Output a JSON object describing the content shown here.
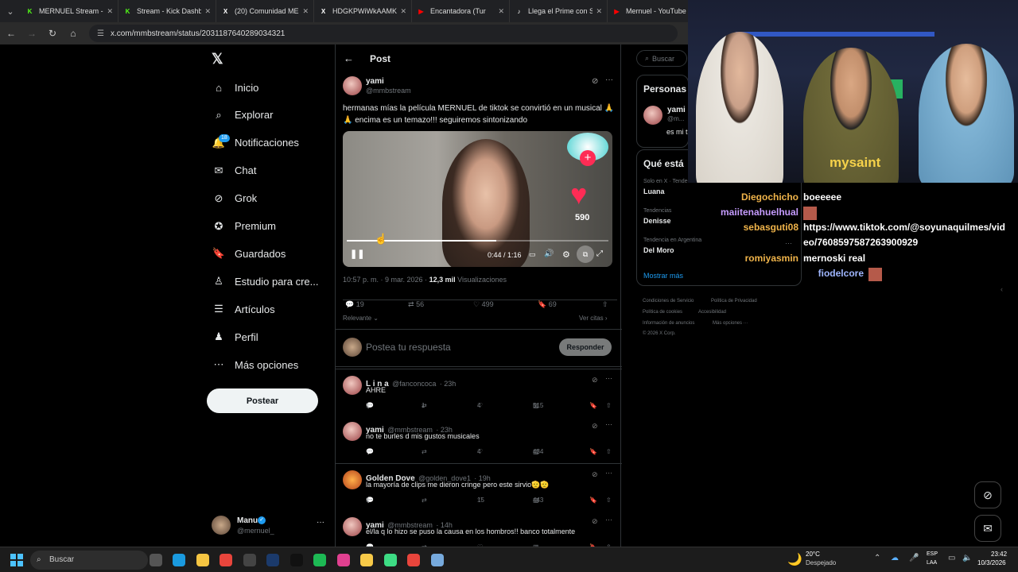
{
  "browser": {
    "tabs": [
      {
        "title": "MERNUEL Stream - V",
        "color": "#53fc18",
        "glyph": "K"
      },
      {
        "title": "Stream - Kick Dashbo",
        "color": "#53fc18",
        "glyph": "K"
      },
      {
        "title": "(20) Comunidad MER",
        "color": "#ffffff",
        "glyph": "X"
      },
      {
        "title": "HDGKPWiWkAAMK8",
        "color": "#ffffff",
        "glyph": "X"
      },
      {
        "title": "Encantadora (Tur",
        "color": "#ff0000",
        "glyph": "▶"
      },
      {
        "title": "Llega el Prime con Sc",
        "color": "#ffffff",
        "glyph": "♪"
      },
      {
        "title": "Mernuel - YouTube",
        "color": "#ff0000",
        "glyph": "▶"
      }
    ],
    "url": "x.com/mmbstream/status/2031187640289034321"
  },
  "sidebar": {
    "items": [
      {
        "label": "Inicio",
        "icon": "home-icon"
      },
      {
        "label": "Explorar",
        "icon": "search-icon"
      },
      {
        "label": "Notificaciones",
        "icon": "bell-icon"
      },
      {
        "label": "Chat",
        "icon": "mail-icon"
      },
      {
        "label": "Grok",
        "icon": "grok-icon"
      },
      {
        "label": "Premium",
        "icon": "premium-icon"
      },
      {
        "label": "Guardados",
        "icon": "bookmark-icon"
      },
      {
        "label": "Estudio para cre...",
        "icon": "studio-icon"
      },
      {
        "label": "Artículos",
        "icon": "articles-icon"
      },
      {
        "label": "Perfil",
        "icon": "person-icon"
      },
      {
        "label": "Más opciones",
        "icon": "more-icon"
      }
    ],
    "notif_badge": "18",
    "post_button": "Postear",
    "account": {
      "name": "Manu",
      "handle": "@mernuel_"
    }
  },
  "post": {
    "header_title": "Post",
    "author": "yami",
    "handle": "@mmbstream",
    "text": "hermanas mías la película MERNUEL de tiktok se convirtió en un musical 🙏🙏 encima es un temazo!!! seguiremos sintonizando",
    "video": {
      "time": "0:44 / 1:16",
      "like_count": "590",
      "progress": 0.57
    },
    "timestamp": "10:57 p. m. · 9 mar. 2026 ·",
    "views": "12,3 mil",
    "views_label": "Visualizaciones",
    "stats": {
      "replies": "19",
      "reposts": "56",
      "likes": "499",
      "bookmarks": "69"
    },
    "sort_label": "Relevante",
    "quotes_link": "Ver citas",
    "reply_placeholder": "Postea tu respuesta",
    "reply_button": "Responder"
  },
  "replies": [
    {
      "name": "L i n a",
      "handle": "@fanconcoca",
      "time": "· 23h",
      "text": "AHRE",
      "replies": "1",
      "reposts": "1",
      "likes": "4",
      "views": "515"
    },
    {
      "name": "yami",
      "handle": "@mmbstream",
      "time": "· 23h",
      "text": "no te burles d mis gustos musicales",
      "replies": "",
      "reposts": "",
      "likes": "4",
      "views": "434"
    },
    {
      "name": "Golden Dove",
      "handle": "@golden_dove1",
      "time": "· 19h",
      "text": "la mayoría de clips me dieron cringe pero este sirvio🫡🫡",
      "replies": "1",
      "reposts": "",
      "likes": "15",
      "views": "443"
    },
    {
      "name": "yami",
      "handle": "@mmbstream",
      "time": "· 14h",
      "text": "el/la q lo hizo se puso la causa en los hombros!! banco totalmente",
      "replies": "",
      "reposts": "",
      "likes": "",
      "views": ""
    }
  ],
  "right": {
    "search_placeholder": "Buscar",
    "people_title": "Personas",
    "people": [
      {
        "name": "yami",
        "handle": "@m...",
        "bio": "es mi t"
      }
    ],
    "trends_title": "Qué está",
    "trends": [
      {
        "context": "Solo en X · Tendencia",
        "name": "Luana"
      },
      {
        "context": "Tendencias",
        "name": "Denisse"
      },
      {
        "context": "Tendencia en Argentina",
        "name": "Del Moro"
      }
    ],
    "show_more": "Mostrar más",
    "footer": [
      "Condiciones de Servicio",
      "Política de Privacidad",
      "Política de cookies",
      "Accesibilidad",
      "Información de anuncios",
      "Más opciones ···",
      "© 2026 X Corp."
    ]
  },
  "stream_chat": [
    {
      "user": "Diegochicho",
      "color": "#f0b44a",
      "msg": "boeeeee"
    },
    {
      "user": "maiitenahuelhual",
      "color": "#c69cff",
      "msg": ""
    },
    {
      "user": "sebasguti08",
      "color": "#f0b44a",
      "msg": "https://www.tiktok.com/@soyunaquilmes/vid"
    },
    {
      "user": "",
      "color": "#ffffff",
      "msg": "eo/7608597587263900929"
    },
    {
      "user": "romiyasmin",
      "color": "#f0b44a",
      "msg": "mernoski real"
    },
    {
      "user": "fiodelcore",
      "color": "#9fb6ff",
      "msg": ""
    }
  ],
  "webcam": {
    "shirt_text": "mysaint"
  },
  "taskbar": {
    "search": "Buscar",
    "weather": {
      "temp": "20°C",
      "desc": "Despejado"
    },
    "lang": [
      "ESP",
      "LAA"
    ],
    "clock": {
      "time": "23:42",
      "date": "10/3/2026"
    }
  }
}
